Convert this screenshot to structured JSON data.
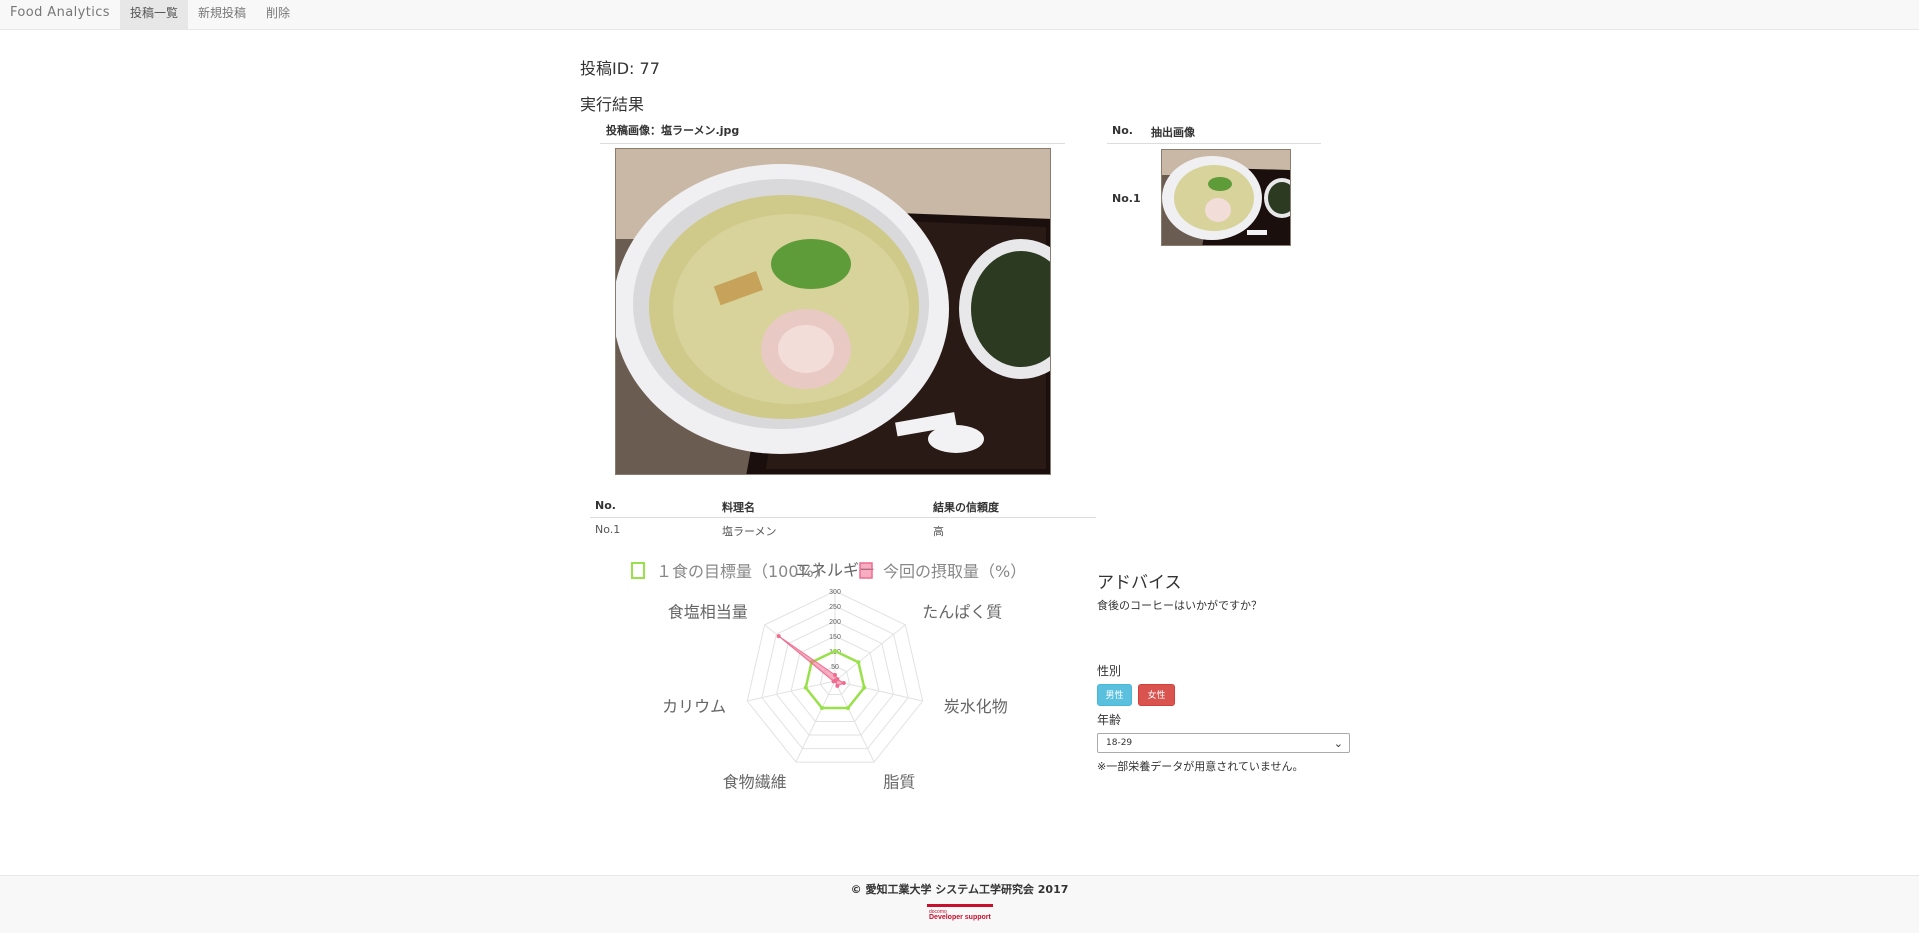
{
  "nav": {
    "brand": "Food Analytics",
    "items": [
      {
        "label": "投稿一覧",
        "active": true
      },
      {
        "label": "新規投稿",
        "active": false
      },
      {
        "label": "削除",
        "active": false
      }
    ]
  },
  "post": {
    "id_label": "投稿ID: 77",
    "section_title": "実行結果",
    "image_header": "投稿画像：塩ラーメン.jpg"
  },
  "extracted": {
    "header_no": "No.",
    "header_image": "抽出画像",
    "rows": [
      {
        "no": "No.1"
      }
    ]
  },
  "results": {
    "headers": {
      "no": "No.",
      "name": "料理名",
      "confidence": "結果の信頼度"
    },
    "rows": [
      {
        "no": "No.1",
        "name": "塩ラーメン",
        "confidence": "高"
      }
    ]
  },
  "chart_data": {
    "type": "radar",
    "legend": [
      "１食の目標量（100%）",
      "今回の摂取量（%）"
    ],
    "axes": [
      "エネルギー",
      "たんぱく質",
      "炭水化物",
      "脂質",
      "食物繊維",
      "カリウム",
      "食塩相当量"
    ],
    "ticks": [
      "50",
      "100",
      "150",
      "200",
      "250",
      "300"
    ],
    "range": [
      0,
      300
    ],
    "series": [
      {
        "name": "１食の目標量（100%）",
        "color": "#99e14a",
        "values": [
          100,
          100,
          100,
          100,
          100,
          100,
          100
        ]
      },
      {
        "name": "今回の摂取量（%）",
        "color": "#f06c8f",
        "values": [
          20,
          10,
          30,
          18,
          0,
          5,
          240
        ]
      }
    ]
  },
  "advice": {
    "title": "アドバイス",
    "text": "食後のコーヒーはいかがですか？",
    "gender_label": "性別",
    "male": "男性",
    "female": "女性",
    "age_label": "年齢",
    "age_value": "18-29",
    "note": "※一部栄養データが用意されていません。"
  },
  "footer": {
    "text": "© 愛知工業大学 システム工学研究会 2017",
    "logo_small": "docomo",
    "logo_main": "Developer support"
  }
}
